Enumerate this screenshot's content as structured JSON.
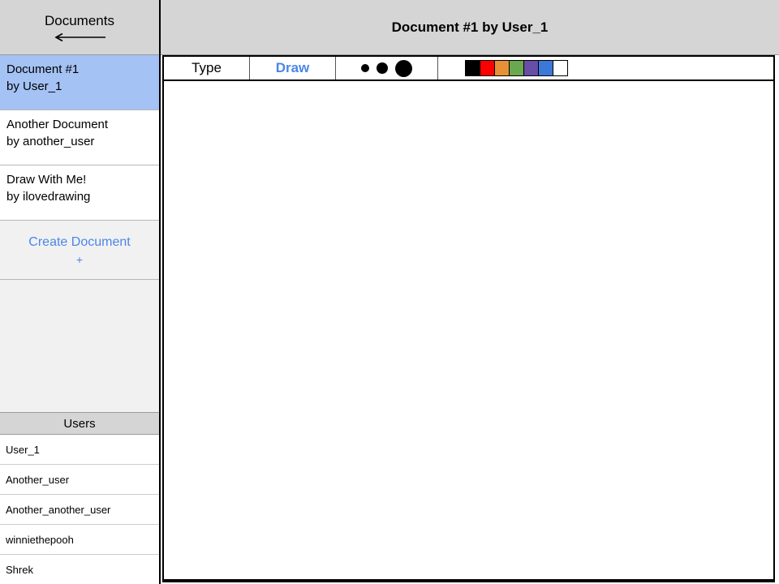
{
  "sidebar": {
    "documents_header": {
      "title": "Documents",
      "back_icon": "arrow-left-icon"
    },
    "documents": [
      {
        "title": "Document #1",
        "author": "by User_1",
        "selected": true
      },
      {
        "title": "Another Document",
        "author": "by another_user",
        "selected": false
      },
      {
        "title": "Draw With Me!",
        "author": "by ilovedrawing",
        "selected": false
      }
    ],
    "create_document": {
      "label": "Create Document",
      "plus": "+"
    },
    "users_header": "Users",
    "users": [
      "User_1",
      "Another_user",
      "Another_another_user",
      "winniethepooh",
      "Shrek"
    ]
  },
  "main": {
    "document_title": "Document #1 by User_1",
    "toolbar": {
      "tabs": [
        {
          "label": "Type",
          "active": false
        },
        {
          "label": "Draw",
          "active": true
        }
      ],
      "brush_sizes": [
        "small",
        "medium",
        "large"
      ],
      "palette": [
        {
          "name": "black",
          "hex": "#000000"
        },
        {
          "name": "red",
          "hex": "#ff0000"
        },
        {
          "name": "orange",
          "hex": "#e69138"
        },
        {
          "name": "green",
          "hex": "#6aa84f"
        },
        {
          "name": "purple",
          "hex": "#674ea7"
        },
        {
          "name": "blue",
          "hex": "#3c78d8"
        },
        {
          "name": "white",
          "hex": "#ffffff"
        }
      ]
    },
    "canvas": {
      "content": ""
    }
  },
  "colors": {
    "selection_blue": "#a4c2f4",
    "link_blue": "#4a86e8",
    "header_gray": "#d5d5d5",
    "panel_gray": "#f1f1f1"
  }
}
